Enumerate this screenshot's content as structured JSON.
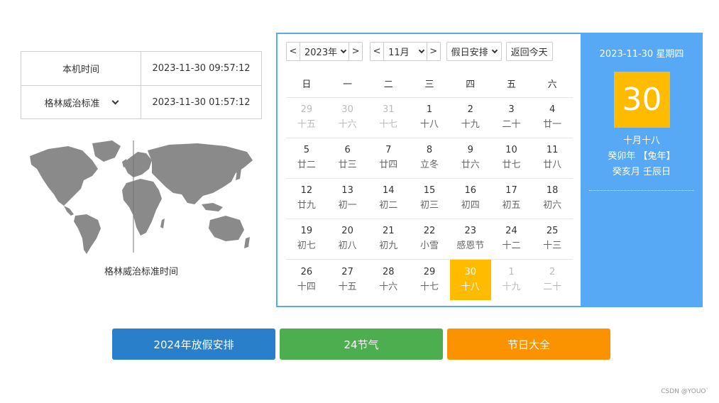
{
  "clock": {
    "local_label": "本机时间",
    "local_time": "2023-11-30 09:57:12",
    "tz_label": "格林威治标准",
    "tz_time": "2023-11-30 01:57:12"
  },
  "map": {
    "caption": "格林威治标准时间",
    "land_color": "#8a8a8a"
  },
  "calendar": {
    "prev_year": "<",
    "year": "2023年",
    "next_year": ">",
    "prev_month": "<",
    "month": "11月",
    "next_month": ">",
    "holiday_select": "假日安排",
    "today_button": "返回今天",
    "weekdays": [
      "日",
      "一",
      "二",
      "三",
      "四",
      "五",
      "六"
    ],
    "weeks": [
      [
        {
          "d": "29",
          "l": "十五",
          "other": true
        },
        {
          "d": "30",
          "l": "十六",
          "other": true
        },
        {
          "d": "31",
          "l": "十七",
          "other": true
        },
        {
          "d": "1",
          "l": "十八"
        },
        {
          "d": "2",
          "l": "十九"
        },
        {
          "d": "3",
          "l": "二十"
        },
        {
          "d": "4",
          "l": "廿一"
        }
      ],
      [
        {
          "d": "5",
          "l": "廿二"
        },
        {
          "d": "6",
          "l": "廿三"
        },
        {
          "d": "7",
          "l": "廿四"
        },
        {
          "d": "8",
          "l": "立冬"
        },
        {
          "d": "9",
          "l": "廿六"
        },
        {
          "d": "10",
          "l": "廿七"
        },
        {
          "d": "11",
          "l": "廿八"
        }
      ],
      [
        {
          "d": "12",
          "l": "廿九"
        },
        {
          "d": "13",
          "l": "初一"
        },
        {
          "d": "14",
          "l": "初二"
        },
        {
          "d": "15",
          "l": "初三"
        },
        {
          "d": "16",
          "l": "初四"
        },
        {
          "d": "17",
          "l": "初五"
        },
        {
          "d": "18",
          "l": "初六"
        }
      ],
      [
        {
          "d": "19",
          "l": "初七"
        },
        {
          "d": "20",
          "l": "初八"
        },
        {
          "d": "21",
          "l": "初九"
        },
        {
          "d": "22",
          "l": "小雪"
        },
        {
          "d": "23",
          "l": "感恩节"
        },
        {
          "d": "24",
          "l": "十二"
        },
        {
          "d": "25",
          "l": "十三"
        }
      ],
      [
        {
          "d": "26",
          "l": "十四"
        },
        {
          "d": "27",
          "l": "十五"
        },
        {
          "d": "28",
          "l": "十六"
        },
        {
          "d": "29",
          "l": "十七"
        },
        {
          "d": "30",
          "l": "十八",
          "today": true
        },
        {
          "d": "1",
          "l": "十九",
          "other": true
        },
        {
          "d": "2",
          "l": "二十",
          "other": true
        }
      ]
    ],
    "today_color": "#ffbb00",
    "border_color": "#58a9ee"
  },
  "side": {
    "date_line": "2023-11-30 星期四",
    "big_day": "30",
    "lunar_day": "十月十八",
    "year_line": "癸卯年 【兔年】",
    "month_line": "癸亥月 壬辰日",
    "background": "#57a9f5"
  },
  "buttons": {
    "holiday_2024": "2024年放假安排",
    "solar_terms": "24节气",
    "festivals": "节日大全"
  },
  "watermark": "CSDN @YOUO`"
}
